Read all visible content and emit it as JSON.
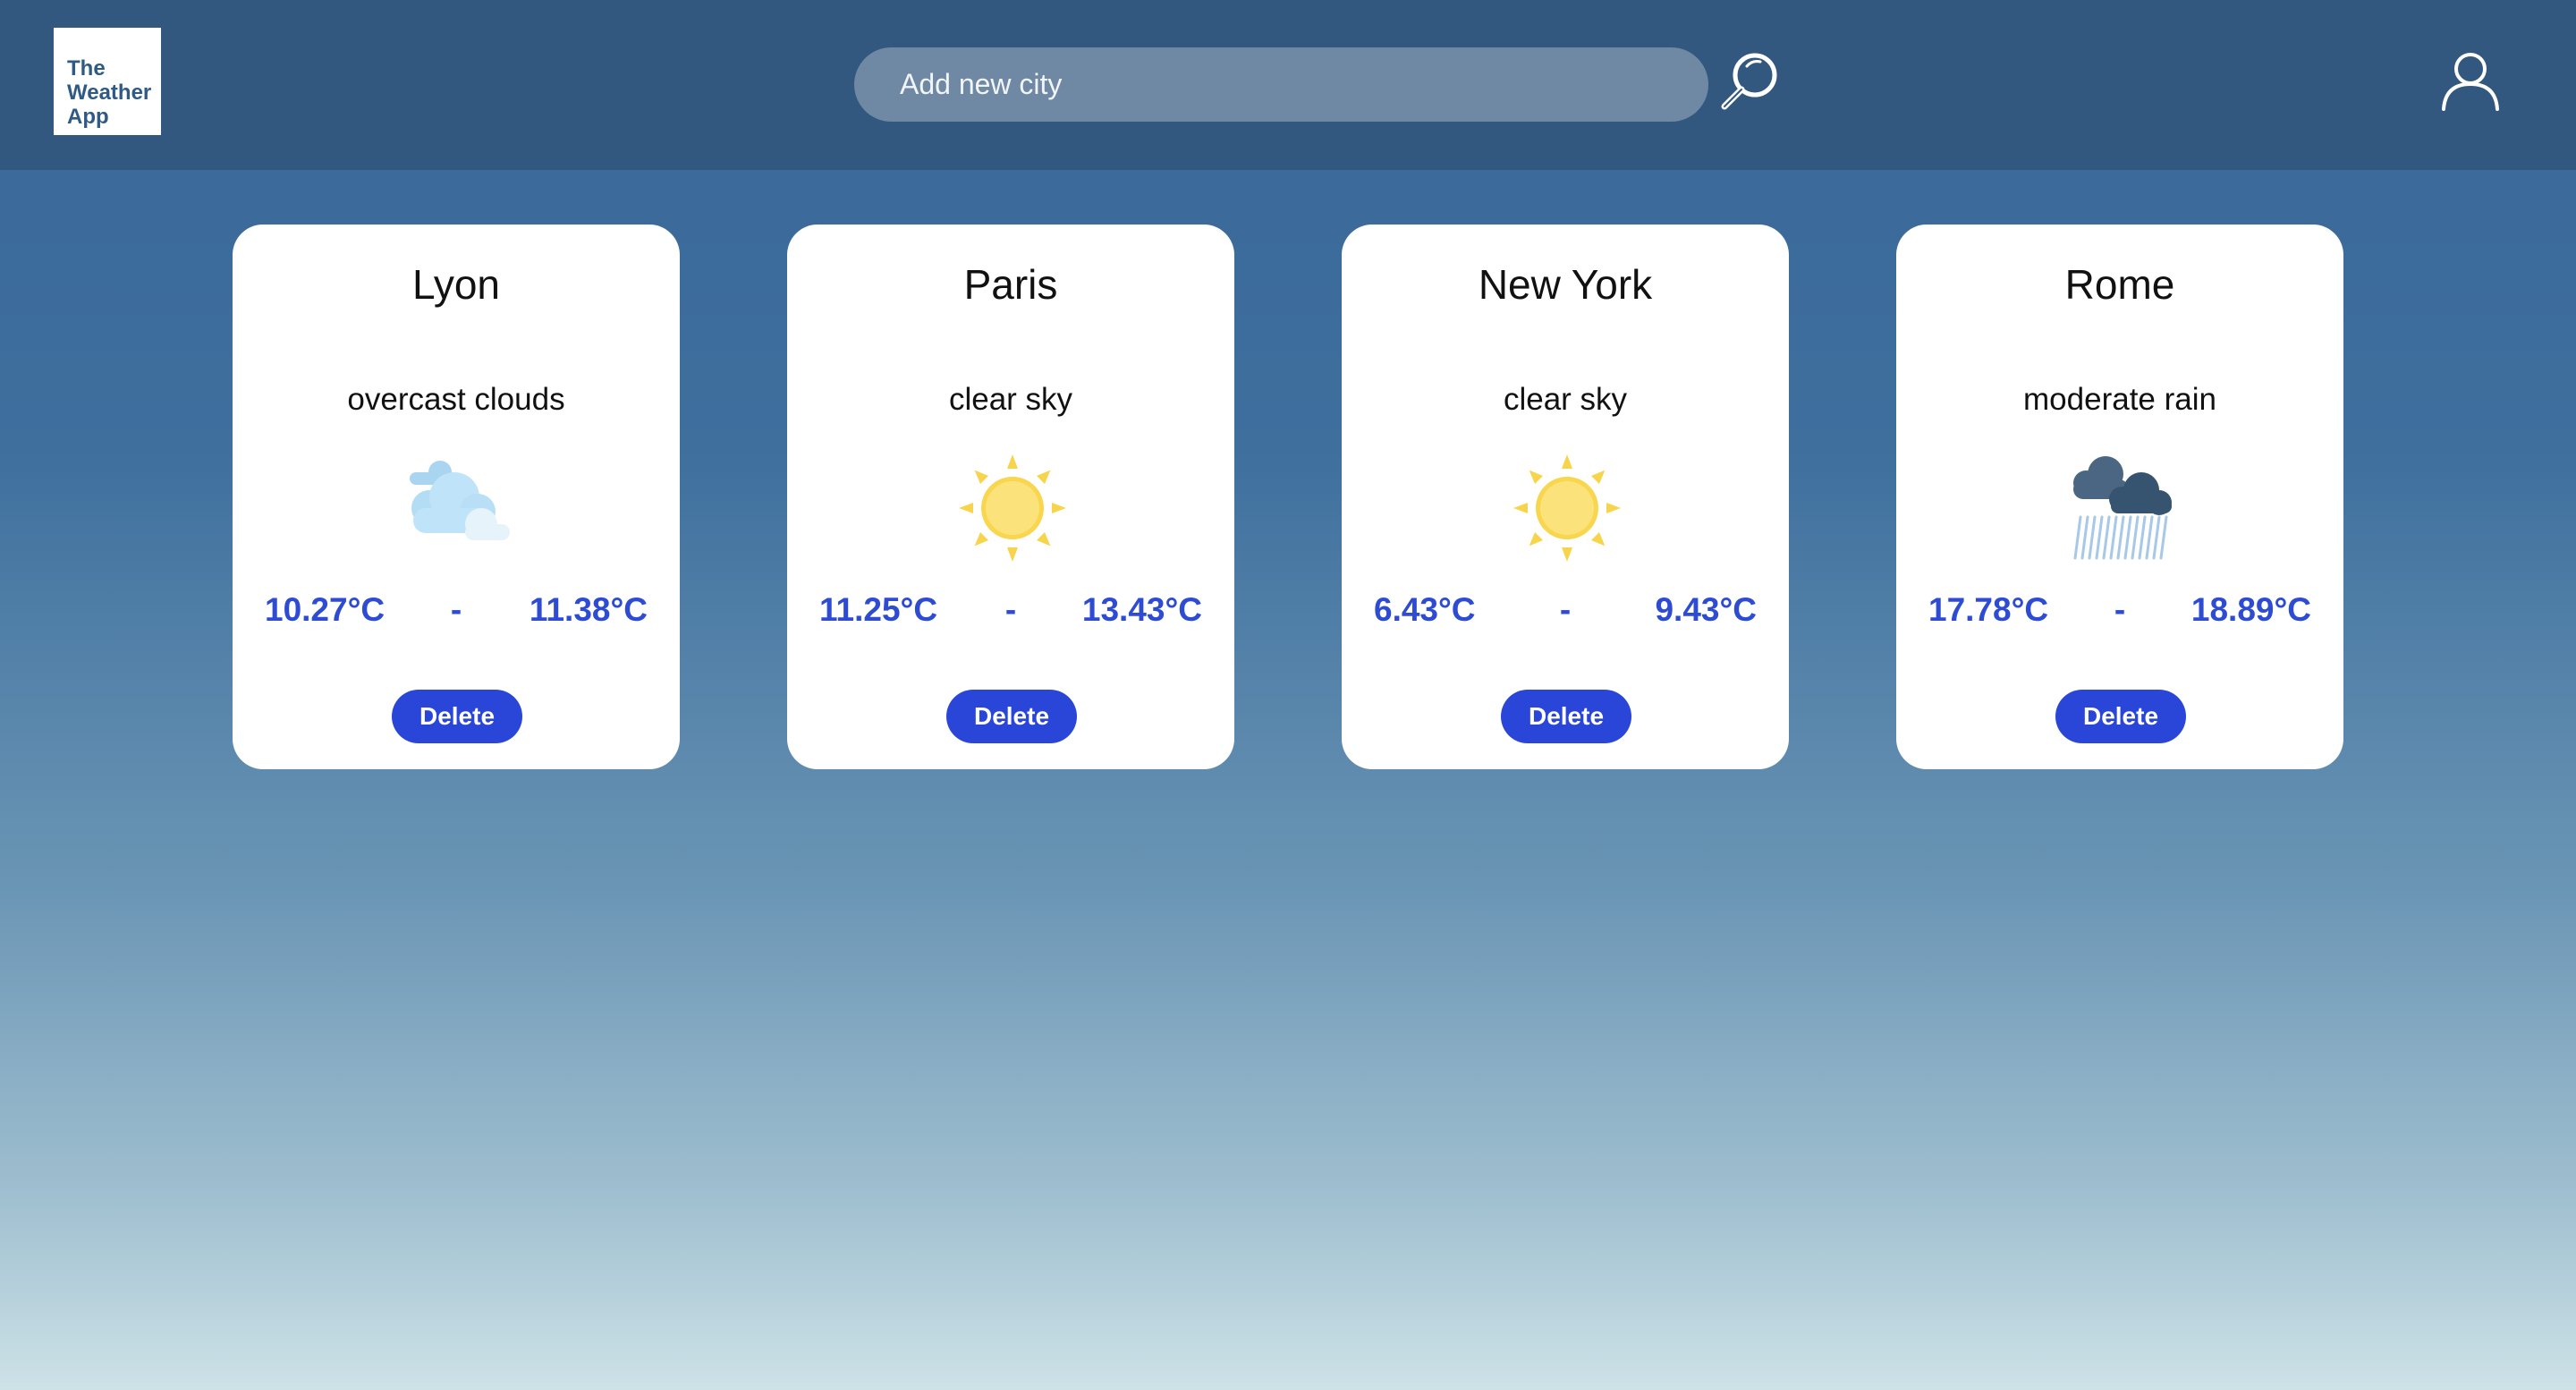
{
  "app": {
    "logo_line1": "The",
    "logo_line2": "Weather",
    "logo_line3": "App"
  },
  "search": {
    "placeholder": "Add new city",
    "icon": "magnifier-icon"
  },
  "user": {
    "icon": "user-icon"
  },
  "colors": {
    "header": "#33587f",
    "accent": "#2946d8",
    "temperature": "#2e4bd3",
    "search_bg": "#6f89a5"
  },
  "cities": [
    {
      "name": "Lyon",
      "description": "overcast clouds",
      "icon": "overcast-clouds-icon",
      "temp_min": "10.27°C",
      "separator": "-",
      "temp_max": "11.38°C",
      "delete_label": "Delete"
    },
    {
      "name": "Paris",
      "description": "clear sky",
      "icon": "sun-icon",
      "temp_min": "11.25°C",
      "separator": "-",
      "temp_max": "13.43°C",
      "delete_label": "Delete"
    },
    {
      "name": "New York",
      "description": "clear sky",
      "icon": "sun-icon",
      "temp_min": "6.43°C",
      "separator": "-",
      "temp_max": "9.43°C",
      "delete_label": "Delete"
    },
    {
      "name": "Rome",
      "description": "moderate rain",
      "icon": "rain-cloud-icon",
      "temp_min": "17.78°C",
      "separator": "-",
      "temp_max": "18.89°C",
      "delete_label": "Delete"
    }
  ]
}
